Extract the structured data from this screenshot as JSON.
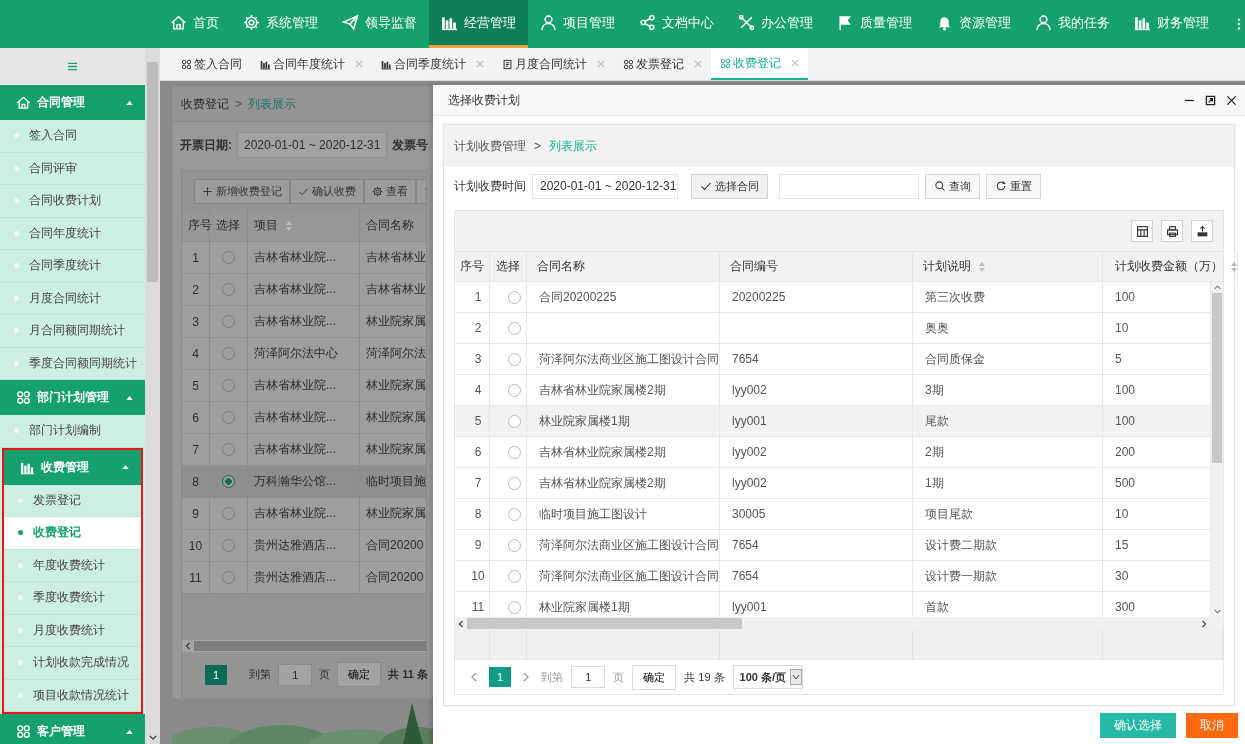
{
  "top_nav": {
    "items": [
      {
        "kind": "home",
        "label": "首页",
        "selected": false
      },
      {
        "kind": "gear",
        "label": "系统管理",
        "selected": false
      },
      {
        "kind": "plane",
        "label": "领导监督",
        "selected": false
      },
      {
        "kind": "bars",
        "label": "经营管理",
        "selected": true
      },
      {
        "kind": "person",
        "label": "项目管理",
        "selected": false
      },
      {
        "kind": "share",
        "label": "文档中心",
        "selected": false
      },
      {
        "kind": "tools",
        "label": "办公管理",
        "selected": false
      },
      {
        "kind": "flag",
        "label": "质量管理",
        "selected": false
      },
      {
        "kind": "bell",
        "label": "资源管理",
        "selected": false
      },
      {
        "kind": "person",
        "label": "我的任务",
        "selected": false
      },
      {
        "kind": "bars",
        "label": "财务管理",
        "selected": false
      }
    ]
  },
  "sidebar": {
    "groups": [
      {
        "kind": "home",
        "title": "合同管理",
        "expanded": true,
        "outlined": false,
        "items": [
          {
            "label": "签入合同",
            "selected": false
          },
          {
            "label": "合同评审",
            "selected": false
          },
          {
            "label": "合同收费计划",
            "selected": false
          },
          {
            "label": "合同年度统计",
            "selected": false
          },
          {
            "label": "合同季度统计",
            "selected": false
          },
          {
            "label": "月度合同统计",
            "selected": false
          },
          {
            "label": "月合同额同期统计",
            "selected": false
          },
          {
            "label": "季度合同额同期统计",
            "selected": false
          }
        ]
      },
      {
        "kind": "grid",
        "title": "部门计划管理",
        "expanded": true,
        "outlined": false,
        "items": [
          {
            "label": "部门计划编制",
            "selected": false
          }
        ]
      },
      {
        "kind": "bars",
        "title": "收费管理",
        "expanded": true,
        "outlined": true,
        "items": [
          {
            "label": "发票登记",
            "selected": false
          },
          {
            "label": "收费登记",
            "selected": true
          },
          {
            "label": "年度收费统计",
            "selected": false
          },
          {
            "label": "季度收费统计",
            "selected": false
          },
          {
            "label": "月度收费统计",
            "selected": false
          },
          {
            "label": "计划收款完成情况",
            "selected": false
          },
          {
            "label": "项目收款情况统计",
            "selected": false
          }
        ]
      },
      {
        "kind": "grid",
        "title": "客户管理",
        "expanded": true,
        "outlined": false
      }
    ]
  },
  "tabs": [
    {
      "kind": "grid",
      "label": "签入合同",
      "selected": false,
      "closable": false
    },
    {
      "kind": "bars",
      "label": "合同年度统计",
      "selected": false,
      "closable": true
    },
    {
      "kind": "bars",
      "label": "合同季度统计",
      "selected": false,
      "closable": true
    },
    {
      "kind": "doc",
      "label": "月度合同统计",
      "selected": false,
      "closable": true
    },
    {
      "kind": "grid",
      "label": "发票登记",
      "selected": false,
      "closable": true
    },
    {
      "kind": "grid",
      "label": "收费登记",
      "selected": true,
      "closable": true
    }
  ],
  "background_page": {
    "breadcrumb": {
      "items": [
        "收费登记",
        "列表展示"
      ],
      "separator": ">"
    },
    "date_filter": {
      "label": "开票日期:",
      "value": "2020-01-01 ~ 2020-12-31"
    },
    "invoice_filter_label": "发票号",
    "toolbar": [
      {
        "kind": "plus",
        "label": "新增收费登记"
      },
      {
        "kind": "check",
        "label": "确认收费"
      },
      {
        "kind": "gear",
        "label": "查看"
      },
      {
        "kind": "trash"
      }
    ],
    "columns": [
      {
        "label": "序号"
      },
      {
        "label": "选择"
      },
      {
        "label": "项目",
        "sortable": true
      },
      {
        "label": "合同名称",
        "sortable": false
      }
    ],
    "rows": [
      {
        "no": "1",
        "project": "吉林省林业院...",
        "contract": "吉林省林业",
        "selected": false
      },
      {
        "no": "2",
        "project": "吉林省林业院...",
        "contract": "吉林省林业",
        "selected": false
      },
      {
        "no": "3",
        "project": "吉林省林业院...",
        "contract": "林业院家属",
        "selected": false
      },
      {
        "no": "4",
        "project": "菏泽阿尔法中心",
        "contract": "菏泽阿尔法",
        "selected": false
      },
      {
        "no": "5",
        "project": "吉林省林业院...",
        "contract": "林业院家属",
        "selected": false
      },
      {
        "no": "6",
        "project": "吉林省林业院...",
        "contract": "林业院家属",
        "selected": false
      },
      {
        "no": "7",
        "project": "吉林省林业院...",
        "contract": "林业院家属",
        "selected": false
      },
      {
        "no": "8",
        "project": "万科瀚华公馆...",
        "contract": "临时项目施",
        "selected": true
      },
      {
        "no": "9",
        "project": "吉林省林业院...",
        "contract": "林业院家属",
        "selected": false
      },
      {
        "no": "10",
        "project": "贵州达雅酒店...",
        "contract": "合同20200",
        "selected": false
      },
      {
        "no": "11",
        "project": "贵州达雅酒店...",
        "contract": "合同20200",
        "selected": false
      }
    ],
    "pagination": {
      "current_page": "1",
      "goto_label": "到第",
      "goto_value": "1",
      "page_unit": "页",
      "confirm": "确定",
      "total": "共 11 条"
    }
  },
  "dialog": {
    "title": "选择收费计划",
    "breadcrumb": {
      "items": [
        "计划收费管理",
        "列表展示"
      ],
      "separator": ">"
    },
    "filter": {
      "label": "计划收费时间",
      "date_value": "2020-01-01 ~ 2020-12-31",
      "pick_button": {
        "kind": "check",
        "label": "选择合同"
      },
      "actions": [
        {
          "kind": "search",
          "label": "查询"
        },
        {
          "kind": "refresh",
          "label": "重置"
        }
      ]
    },
    "tools": [
      {
        "kind": "columns"
      },
      {
        "kind": "print"
      },
      {
        "kind": "export"
      }
    ],
    "columns": [
      {
        "label": "序号",
        "sortable": false
      },
      {
        "label": "选择",
        "sortable": false
      },
      {
        "label": "合同名称",
        "sortable": false
      },
      {
        "label": "合同编号",
        "sortable": false
      },
      {
        "label": "计划说明",
        "sortable": true
      },
      {
        "label": "计划收费金额（万）",
        "sortable": true
      }
    ],
    "rows": [
      {
        "no": "1",
        "name": "合同20200225",
        "code": "20200225",
        "note": "第三次收费",
        "amount": "100",
        "selected": false,
        "highlighted": false
      },
      {
        "no": "2",
        "note": "奥奥",
        "amount": "10",
        "selected": false,
        "highlighted": false
      },
      {
        "no": "3",
        "name": "菏泽阿尔法商业区施工图设计合同",
        "code": "7654",
        "note": "合同质保金",
        "amount": "5",
        "selected": false,
        "highlighted": false
      },
      {
        "no": "4",
        "name": "吉林省林业院家属楼2期",
        "code": "lyy002",
        "note": "3期",
        "amount": "100",
        "selected": false,
        "highlighted": false
      },
      {
        "no": "5",
        "name": "林业院家属楼1期",
        "code": "lyy001",
        "note": "尾款",
        "amount": "100",
        "selected": false,
        "highlighted": true
      },
      {
        "no": "6",
        "name": "吉林省林业院家属楼2期",
        "code": "lyy002",
        "note": "2期",
        "amount": "200",
        "selected": false,
        "highlighted": false
      },
      {
        "no": "7",
        "name": "吉林省林业院家属楼2期",
        "code": "lyy002",
        "note": "1期",
        "amount": "500",
        "selected": false,
        "highlighted": false
      },
      {
        "no": "8",
        "name": "临时项目施工图设计",
        "code": "30005",
        "note": "项目尾款",
        "amount": "10",
        "selected": false,
        "highlighted": false
      },
      {
        "no": "9",
        "name": "菏泽阿尔法商业区施工图设计合同",
        "code": "7654",
        "note": "设计费二期款",
        "amount": "15",
        "selected": false,
        "highlighted": false
      },
      {
        "no": "10",
        "name": "菏泽阿尔法商业区施工图设计合同",
        "code": "7654",
        "note": "设计费一期款",
        "amount": "30",
        "selected": false,
        "highlighted": false
      },
      {
        "no": "11",
        "name": "林业院家属楼1期",
        "code": "lyy001",
        "note": "首款",
        "amount": "300",
        "selected": false,
        "highlighted": false
      }
    ],
    "pagination": {
      "current_page": "1",
      "goto_label": "到第",
      "goto_value": "1",
      "page_unit": "页",
      "confirm": "确定",
      "total": "共 19 条",
      "page_size": "100 条/页"
    },
    "buttons": [
      {
        "kind": "primary",
        "label": "确认选择"
      },
      {
        "kind": "danger",
        "label": "取消"
      }
    ]
  }
}
